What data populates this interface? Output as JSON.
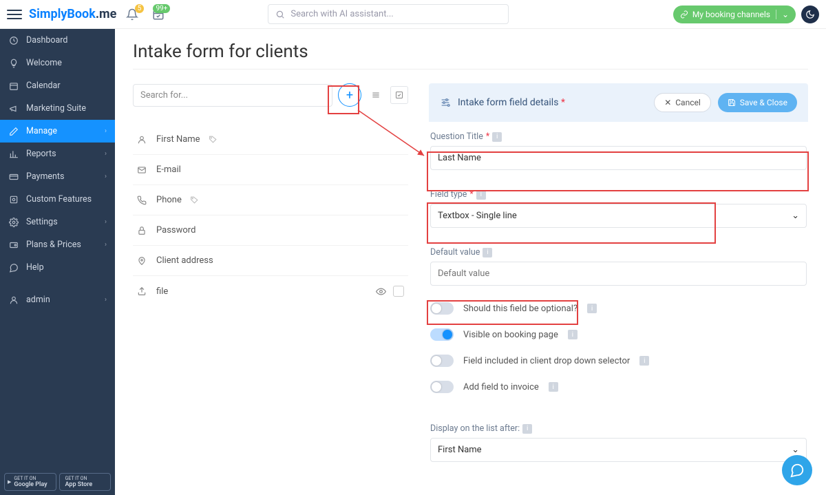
{
  "topbar": {
    "logo_a": "SimplyBook",
    "logo_b": ".me",
    "notif_badge": "5",
    "cal_badge": "99+",
    "search_placeholder": "Search with AI assistant...",
    "booking_channels": "My booking channels"
  },
  "sidebar": {
    "items": [
      {
        "label": "Dashboard"
      },
      {
        "label": "Welcome"
      },
      {
        "label": "Calendar"
      },
      {
        "label": "Marketing Suite"
      },
      {
        "label": "Manage"
      },
      {
        "label": "Reports"
      },
      {
        "label": "Payments"
      },
      {
        "label": "Custom Features"
      },
      {
        "label": "Settings"
      },
      {
        "label": "Plans & Prices"
      },
      {
        "label": "Help"
      }
    ],
    "user": "admin",
    "store1_top": "GET IT ON",
    "store1": "Google Play",
    "store2_top": "GET IT ON",
    "store2": "App Store"
  },
  "page": {
    "title": "Intake form for clients"
  },
  "list": {
    "search_placeholder": "Search for...",
    "items": [
      {
        "label": "First Name"
      },
      {
        "label": "E-mail"
      },
      {
        "label": "Phone"
      },
      {
        "label": "Password"
      },
      {
        "label": "Client address"
      },
      {
        "label": "file"
      }
    ]
  },
  "detail": {
    "header": "Intake form field details",
    "cancel": "Cancel",
    "save": "Save & Close",
    "question_label": "Question Title",
    "question_value": "Last Name",
    "fieldtype_label": "Field type",
    "fieldtype_value": "Textbox - Single line",
    "default_label": "Default value",
    "default_placeholder": "Default value",
    "opt_label": "Should this field be optional?",
    "visible_label": "Visible on booking page",
    "dropdown_label": "Field included in client drop down selector",
    "invoice_label": "Add field to invoice",
    "display_after_label": "Display on the list after:",
    "display_after_value": "First Name"
  }
}
